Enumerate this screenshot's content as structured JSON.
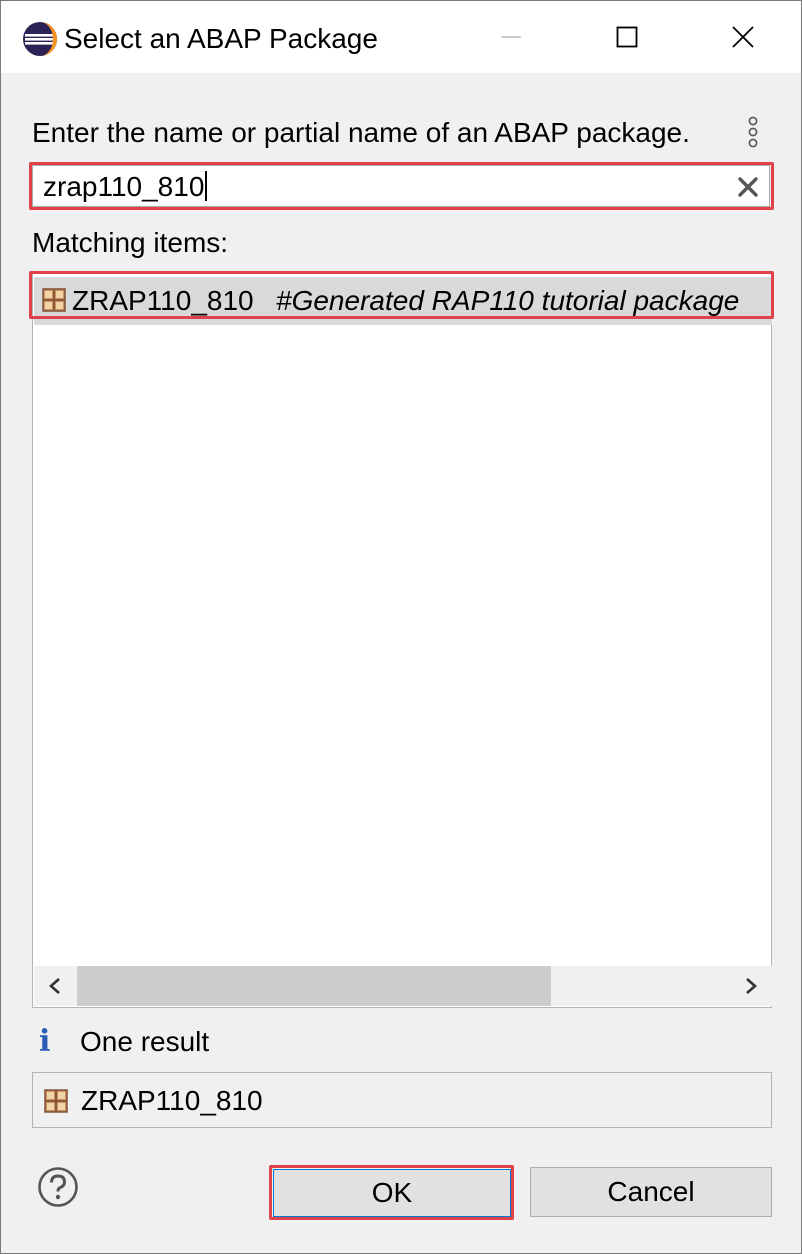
{
  "window": {
    "title": "Select an ABAP Package"
  },
  "prompt": {
    "label": "Enter the name or partial name of an ABAP package."
  },
  "search": {
    "value": "zrap110_810"
  },
  "results": {
    "label": "Matching items:",
    "items": [
      {
        "name": "ZRAP110_810",
        "description": "#Generated RAP110  tutorial package",
        "icon": "package-icon"
      }
    ]
  },
  "status": {
    "icon": "info-icon",
    "text": "One result"
  },
  "selection": {
    "name": "ZRAP110_810",
    "icon": "package-icon"
  },
  "buttons": {
    "ok": "OK",
    "cancel": "Cancel"
  },
  "colors": {
    "highlight": "#e0424a",
    "info": "#2a5bb5",
    "selected_row": "#d9d9d9"
  }
}
